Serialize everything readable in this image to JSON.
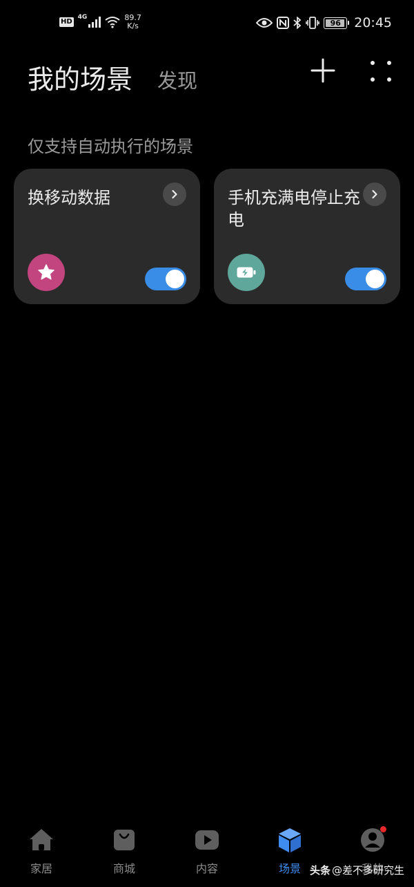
{
  "status_bar": {
    "hd": "HD",
    "network": "4G",
    "speed_value": "89.7",
    "speed_unit": "K/s",
    "battery": "96",
    "battery_level": 0.96,
    "time": "20:45"
  },
  "header": {
    "title": "我的场景",
    "discover": "发现",
    "add_icon": "plus-icon",
    "more_icon": "four-dots-icon"
  },
  "section_label": "仅支持自动执行的场景",
  "scenes": [
    {
      "title": "换移动数据",
      "icon": "star-icon",
      "icon_color": "#c2457f",
      "enabled": true
    },
    {
      "title": "手机充满电停止充电",
      "icon": "battery-charging-icon",
      "icon_color": "#5fa79a",
      "enabled": true
    }
  ],
  "bottom_nav": {
    "active_color": "#3f8cf0",
    "items": [
      {
        "label": "家居",
        "icon": "home-icon"
      },
      {
        "label": "商城",
        "icon": "shopping-bag-icon"
      },
      {
        "label": "内容",
        "icon": "play-icon"
      },
      {
        "label": "场景",
        "icon": "cube-icon",
        "active": true
      },
      {
        "label": "我的",
        "icon": "user-icon",
        "badge": true
      }
    ]
  },
  "watermark": {
    "brand": "头条",
    "handle": "@差不多研究生"
  }
}
